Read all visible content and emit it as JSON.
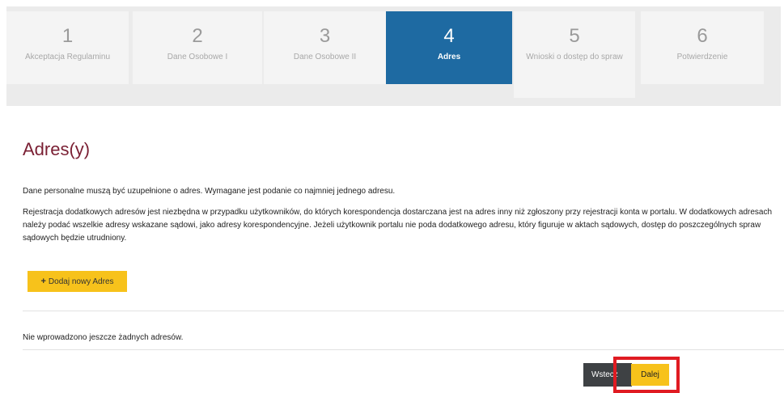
{
  "wizard": {
    "steps": [
      {
        "number": "1",
        "label": "Akceptacja Regulaminu"
      },
      {
        "number": "2",
        "label": "Dane Osobowe I"
      },
      {
        "number": "3",
        "label": "Dane Osobowe II"
      },
      {
        "number": "4",
        "label": "Adres"
      },
      {
        "number": "5",
        "label": "Wnioski o dostęp do spraw"
      },
      {
        "number": "6",
        "label": "Potwierdzenie"
      }
    ],
    "active_step": "4"
  },
  "main": {
    "title": "Adres(y)",
    "intro": "Dane personalne muszą być uzupełnione o adres. Wymagane jest podanie co najmniej jednego adresu.",
    "info": "Rejestracja dodatkowych adresów jest niezbędna w przypadku użytkowników, do których korespondencja dostarczana jest na adres inny niż zgłoszony przy rejestracji konta w portalu. W dodatkowych adresach należy podać wszelkie adresy wskazane sądowi, jako adresy korespondencyjne. Jeżeli użytkownik portalu nie poda dodatkowego adresu, który figuruje w aktach sądowych, dostęp do poszczególnych spraw sądowych będzie utrudniony.",
    "add_button_label": "Dodaj nowy Adres",
    "empty_message": "Nie wprowadzono jeszcze żadnych adresów."
  },
  "footer": {
    "back_label": "Wstecz",
    "next_label": "Dalej"
  },
  "colors": {
    "accent_active_step": "#1e6aa2",
    "title": "#7a1f33",
    "primary_button": "#f7c21b",
    "secondary_button": "#3e4144",
    "highlight": "#e01b22"
  }
}
